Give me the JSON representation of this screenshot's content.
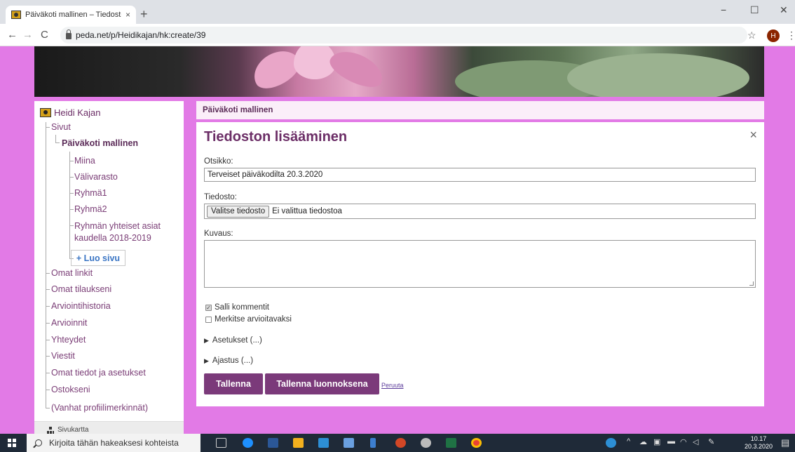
{
  "browser": {
    "tab_title": "Päiväkoti mallinen – Tiedoston lis",
    "tab_close": "×",
    "new_tab": "+",
    "minimize": "−",
    "maximize": "☐",
    "close": "✕",
    "back": "←",
    "forward": "→",
    "reload": "C",
    "url": "peda.net/p/Heidikajan/hk:create/39",
    "bookmark": "☆",
    "profile_initial": "H",
    "menu": "⋮"
  },
  "sidebar": {
    "user_name": "Heidi Kajan",
    "sivut": "Sivut",
    "current_page": "Päiväkoti mallinen",
    "children": [
      "Miina",
      "Välivarasto",
      "Ryhmä1",
      "Ryhmä2",
      "Ryhmän yhteiset asiat kaudella 2018-2019"
    ],
    "create_page": "+ Luo sivu",
    "links": [
      "Omat linkit",
      "Omat tilaukseni",
      "Arviointihistoria",
      "Arvioinnit",
      "Yhteydet",
      "Viestit",
      "Omat tiedot ja asetukset",
      "Ostokseni",
      "(Vanhat profiilimerkinnät)"
    ],
    "sitemap": "Sivukartta"
  },
  "breadcrumb": "Päiväkoti mallinen",
  "form": {
    "title": "Tiedoston lisääminen",
    "close": "×",
    "title_label": "Otsikko:",
    "title_value": "Terveiset päiväkodilta 20.3.2020",
    "file_label": "Tiedosto:",
    "file_button": "Valitse tiedosto",
    "file_status": "Ei valittua tiedostoa",
    "description_label": "Kuvaus:",
    "allow_comments": "Salli kommentit",
    "allow_comments_checked": true,
    "mark_for_grading": "Merkitse arvioitavaksi",
    "mark_for_grading_checked": false,
    "settings": "Asetukset (...)",
    "scheduling": "Ajastus (...)",
    "save": "Tallenna",
    "save_draft": "Tallenna luonnoksena",
    "cancel": "Peruuta"
  },
  "taskbar": {
    "search_placeholder": "Kirjoita tähän hakeaksesi kohteista",
    "time": "10.17",
    "date": "20.3.2020"
  },
  "colors": {
    "page_bg": "#e27ae6",
    "accent": "#7b3a7a",
    "link": "#7a3d76"
  }
}
